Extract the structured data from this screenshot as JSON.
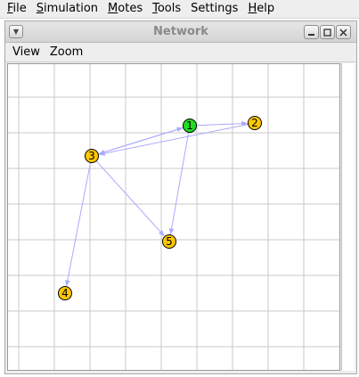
{
  "menubar": {
    "items": [
      {
        "first": "F",
        "rest": "ile"
      },
      {
        "first": "S",
        "rest": "imulation"
      },
      {
        "first": "M",
        "rest": "otes"
      },
      {
        "first": "T",
        "rest": "ools"
      },
      {
        "first": "",
        "rest": "Settings"
      },
      {
        "first": "H",
        "rest": "elp"
      }
    ]
  },
  "window": {
    "title": "Network",
    "menu": [
      "View",
      "Zoom"
    ]
  },
  "colors": {
    "selected_mote": "#22dd22",
    "mote": "#ffc800",
    "link": "#aaaaff",
    "grid": "#c8c8c8"
  },
  "network": {
    "motes": [
      {
        "id": "1",
        "selected": true
      },
      {
        "id": "2",
        "selected": false
      },
      {
        "id": "3",
        "selected": false
      },
      {
        "id": "4",
        "selected": false
      },
      {
        "id": "5",
        "selected": false
      }
    ],
    "links": [
      {
        "from": "1",
        "to": "2"
      },
      {
        "from": "1",
        "to": "3"
      },
      {
        "from": "1",
        "to": "5"
      },
      {
        "from": "2",
        "to": "3"
      },
      {
        "from": "3",
        "to": "1"
      },
      {
        "from": "3",
        "to": "4"
      },
      {
        "from": "3",
        "to": "5"
      }
    ]
  }
}
